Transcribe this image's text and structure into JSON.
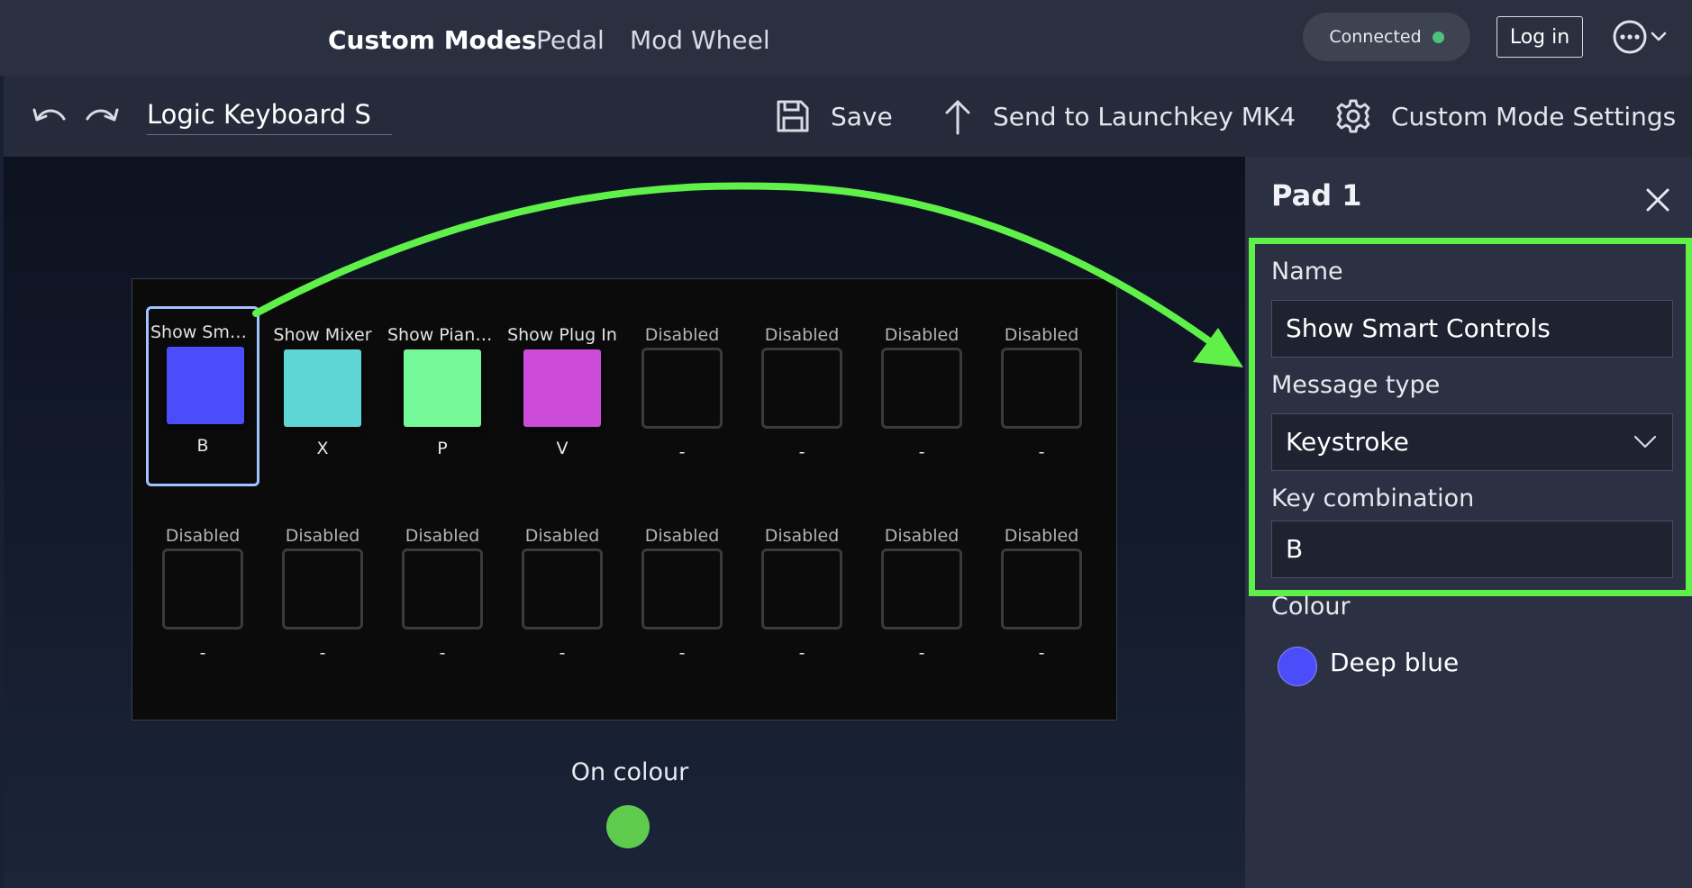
{
  "nav": {
    "tabs": [
      "Custom Modes",
      "Pedal",
      "Mod Wheel"
    ],
    "status_label": "Connected",
    "login_label": "Log in"
  },
  "toolbar": {
    "mode_name": "Logic Keyboard S",
    "save_label": "Save",
    "send_label": "Send to Launchkey MK4",
    "settings_label": "Custom Mode Settings"
  },
  "pads": {
    "row1": [
      {
        "label": "Show Smart ...",
        "key": "B",
        "color": "#4b4dfa",
        "selected": true
      },
      {
        "label": "Show Mixer",
        "key": "X",
        "color": "#5fd6d6",
        "selected": false
      },
      {
        "label": "Show Piano ...",
        "key": "P",
        "color": "#74f898",
        "selected": false
      },
      {
        "label": "Show Plug In",
        "key": "V",
        "color": "#cc4bd9",
        "selected": false
      },
      {
        "label": "Disabled",
        "key": "-",
        "color": null,
        "selected": false
      },
      {
        "label": "Disabled",
        "key": "-",
        "color": null,
        "selected": false
      },
      {
        "label": "Disabled",
        "key": "-",
        "color": null,
        "selected": false
      },
      {
        "label": "Disabled",
        "key": "-",
        "color": null,
        "selected": false
      }
    ],
    "row2": [
      {
        "label": "Disabled",
        "key": "-",
        "color": null,
        "selected": false
      },
      {
        "label": "Disabled",
        "key": "-",
        "color": null,
        "selected": false
      },
      {
        "label": "Disabled",
        "key": "-",
        "color": null,
        "selected": false
      },
      {
        "label": "Disabled",
        "key": "-",
        "color": null,
        "selected": false
      },
      {
        "label": "Disabled",
        "key": "-",
        "color": null,
        "selected": false
      },
      {
        "label": "Disabled",
        "key": "-",
        "color": null,
        "selected": false
      },
      {
        "label": "Disabled",
        "key": "-",
        "color": null,
        "selected": false
      },
      {
        "label": "Disabled",
        "key": "-",
        "color": null,
        "selected": false
      }
    ]
  },
  "on_colour": {
    "label": "On colour",
    "color": "#5fcb4d"
  },
  "panel": {
    "title": "Pad 1",
    "name_label": "Name",
    "name_value": "Show Smart Controls",
    "message_type_label": "Message type",
    "message_type_value": "Keystroke",
    "key_combination_label": "Key combination",
    "key_combination_value": "B",
    "colour_label": "Colour",
    "colour_name": "Deep blue",
    "colour_hex": "#4b4dfa"
  },
  "annotation": {
    "color": "#60f04a"
  }
}
